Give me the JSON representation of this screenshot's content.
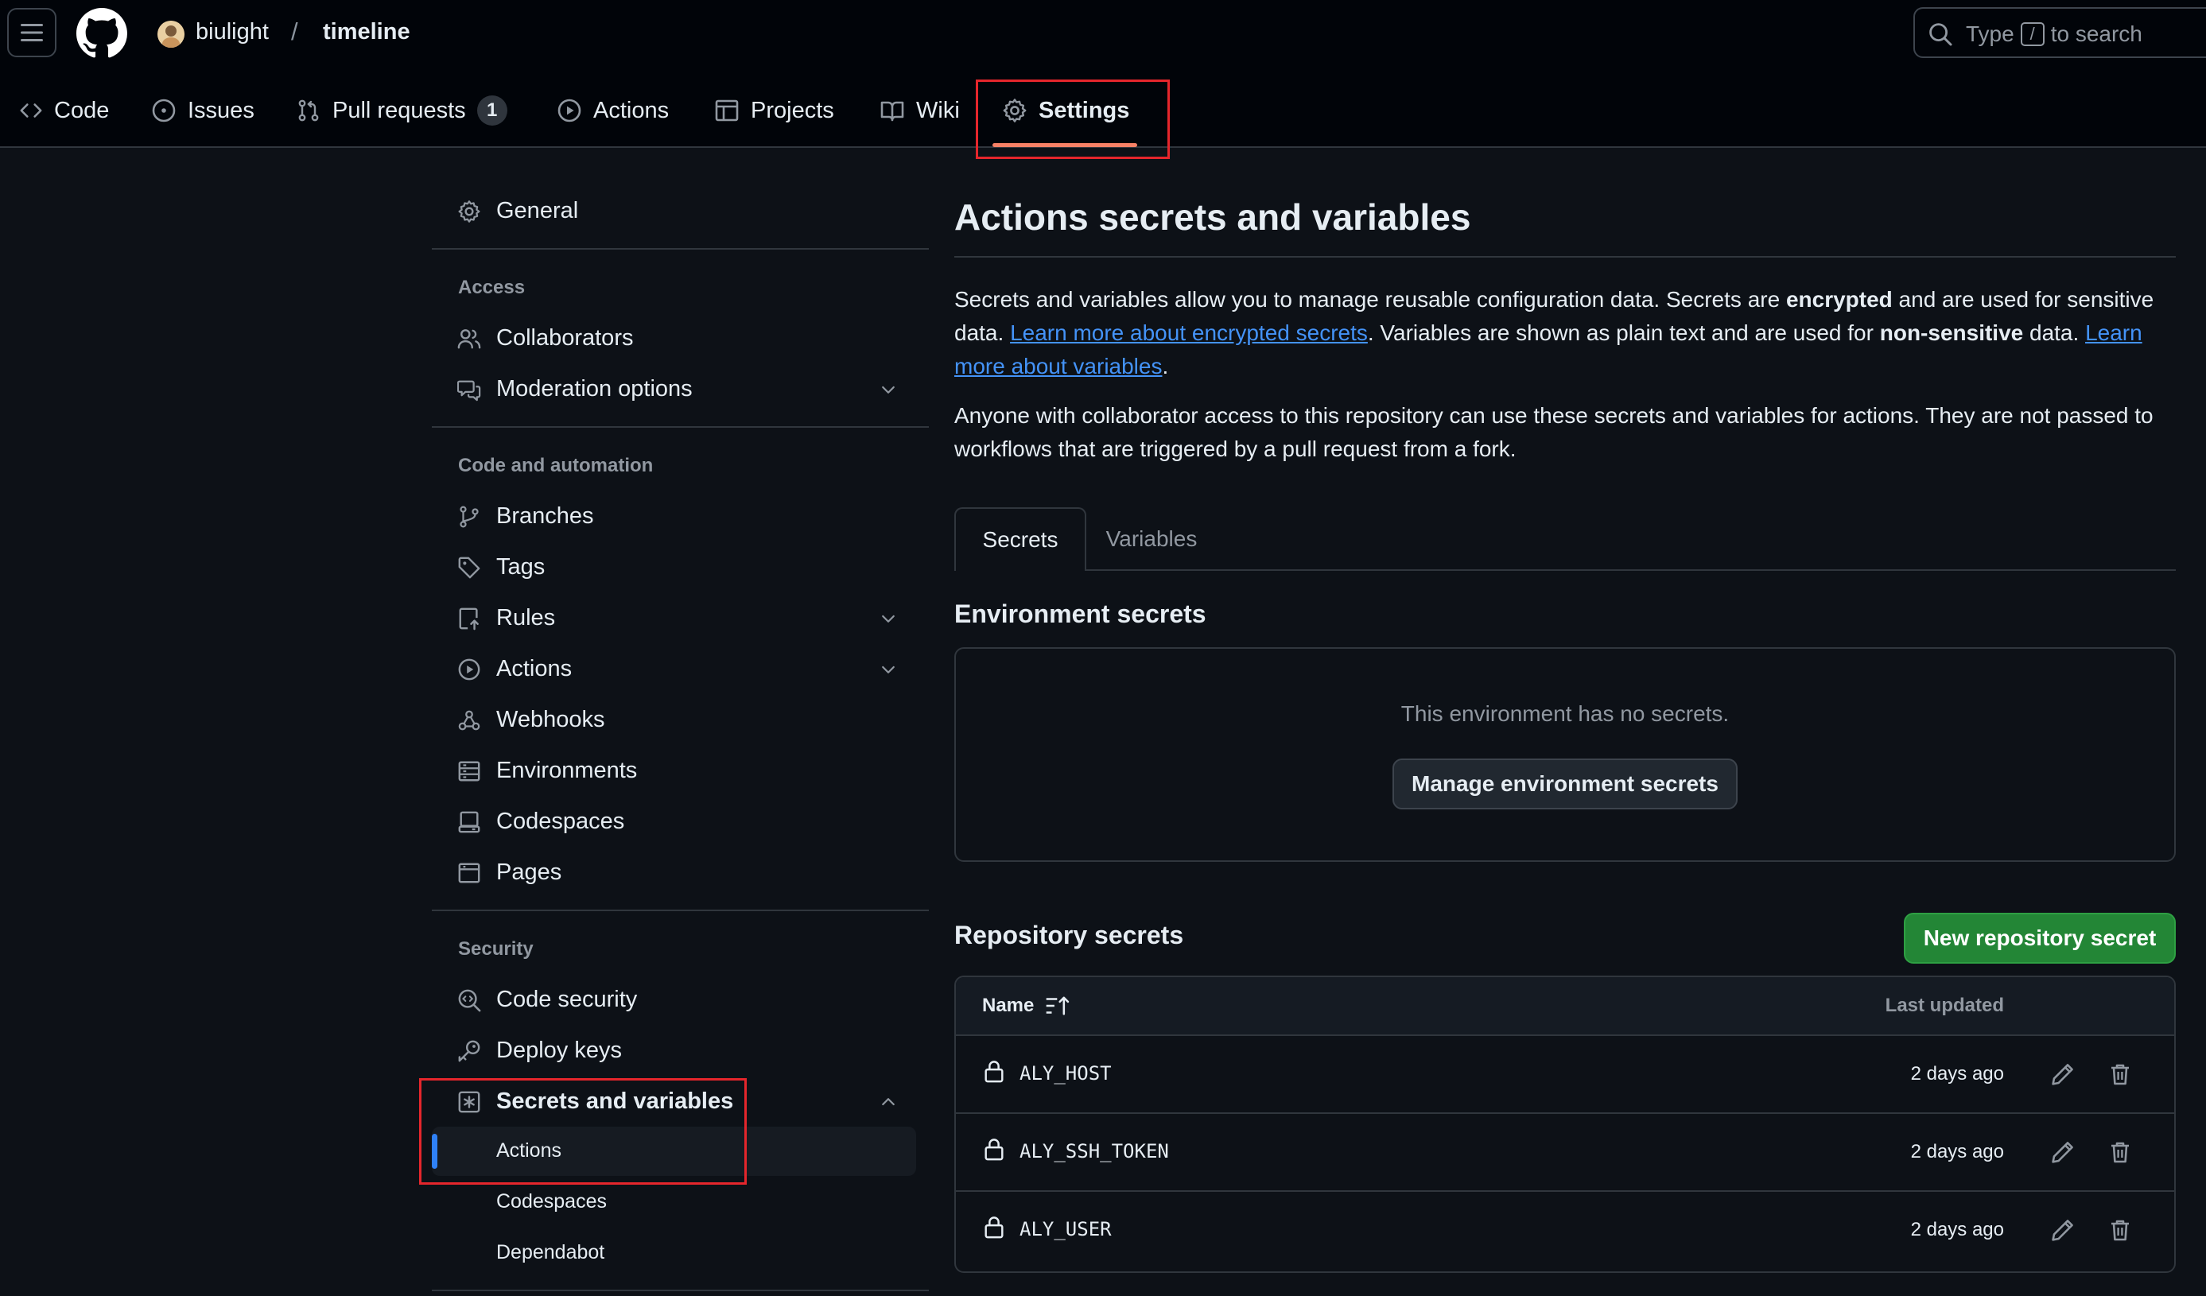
{
  "header": {
    "owner": "biulight",
    "separator": "/",
    "repo": "timeline",
    "search_prefix": "Type",
    "search_key": "/",
    "search_suffix": "to search"
  },
  "nav": {
    "code": "Code",
    "issues": "Issues",
    "pull_requests": "Pull requests",
    "pull_requests_count": "1",
    "actions": "Actions",
    "projects": "Projects",
    "wiki": "Wiki",
    "settings": "Settings"
  },
  "sidebar": {
    "general": "General",
    "access_heading": "Access",
    "collaborators": "Collaborators",
    "moderation": "Moderation options",
    "code_heading": "Code and automation",
    "branches": "Branches",
    "tags": "Tags",
    "rules": "Rules",
    "actions": "Actions",
    "webhooks": "Webhooks",
    "environments": "Environments",
    "codespaces": "Codespaces",
    "pages": "Pages",
    "security_heading": "Security",
    "code_security": "Code security",
    "deploy_keys": "Deploy keys",
    "secrets_vars": "Secrets and variables",
    "sub_actions": "Actions",
    "sub_codespaces": "Codespaces",
    "sub_dependabot": "Dependabot"
  },
  "main": {
    "title": "Actions secrets and variables",
    "p1_a": "Secrets and variables allow you to manage reusable configuration data. Secrets are ",
    "p1_b": "encrypted",
    "p1_c": " and are used for sensitive data. ",
    "p1_link1": "Learn more about encrypted secrets",
    "p1_d": ". Variables are shown as plain text and are used for ",
    "p1_e": "non-sensitive",
    "p1_f": " data. ",
    "p1_link2": "Learn more about variables",
    "p1_g": ".",
    "p2": "Anyone with collaborator access to this repository can use these secrets and variables for actions. They are not passed to workflows that are triggered by a pull request from a fork.",
    "tab_secrets": "Secrets",
    "tab_variables": "Variables",
    "env_title": "Environment secrets",
    "env_empty": "This environment has no secrets.",
    "env_button": "Manage environment secrets",
    "repo_title": "Repository secrets",
    "new_button": "New repository secret",
    "table": {
      "col_name": "Name",
      "col_updated": "Last updated",
      "rows": [
        {
          "name": "ALY_HOST",
          "updated": "2 days ago"
        },
        {
          "name": "ALY_SSH_TOKEN",
          "updated": "2 days ago"
        },
        {
          "name": "ALY_USER",
          "updated": "2 days ago"
        }
      ]
    }
  },
  "colors": {
    "accent_underline": "#f78166",
    "link": "#4493f8",
    "primary_button": "#238636",
    "highlight_box": "#e5262c"
  }
}
